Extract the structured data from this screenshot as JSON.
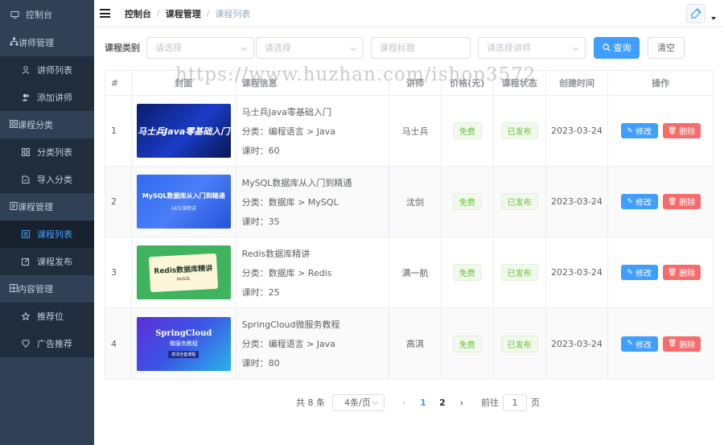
{
  "sidebar": {
    "items": [
      {
        "label": "控制台",
        "icon": "monitor-icon"
      },
      {
        "label": "讲师管理",
        "icon": "org-chart-icon",
        "group": true
      },
      {
        "label": "讲师列表",
        "icon": "user-icon",
        "sub": true
      },
      {
        "label": "添加讲师",
        "icon": "user-add-icon",
        "sub": true
      },
      {
        "label": "课程分类",
        "icon": "grid-icon",
        "group": true
      },
      {
        "label": "分类列表",
        "icon": "grid-icon",
        "sub": true
      },
      {
        "label": "导入分类",
        "icon": "import-icon",
        "sub": true
      },
      {
        "label": "课程管理",
        "icon": "document-icon",
        "group": true
      },
      {
        "label": "课程列表",
        "icon": "list-icon",
        "sub": true,
        "active": true
      },
      {
        "label": "课程发布",
        "icon": "edit-icon",
        "sub": true
      },
      {
        "label": "内容管理",
        "icon": "tile-icon",
        "group": true
      },
      {
        "label": "推荐位",
        "icon": "star-icon",
        "sub": true
      },
      {
        "label": "广告推荐",
        "icon": "diamond-icon",
        "sub": true
      }
    ]
  },
  "header": {
    "breadcrumb": [
      "控制台",
      "课程管理",
      "课程列表"
    ]
  },
  "filter": {
    "label": "课程类别",
    "select1_placeholder": "请选择",
    "select2_placeholder": "请选择",
    "title_placeholder": "课程标题",
    "teacher_placeholder": "请选择讲师",
    "search_label": "查询",
    "clear_label": "清空"
  },
  "table": {
    "headers": [
      "#",
      "封面",
      "课程信息",
      "讲师",
      "价格(元)",
      "课程状态",
      "创建时间",
      "操作"
    ],
    "rows": [
      {
        "no": "1",
        "cover_text": "马士兵Java零基础入门",
        "title": "马士兵Java零基础入门",
        "category": "分类：编程语言 > Java",
        "hours": "课时：60",
        "teacher": "马士兵",
        "price": "免费",
        "status": "已发布",
        "created": "2023-03-24"
      },
      {
        "no": "2",
        "cover_text": "MySQL数据库从入门到精通",
        "cover_sub": "58次课精讲",
        "title": "MySQL数据库从入门到精通",
        "category": "分类：数据库 > MySQL",
        "hours": "课时：35",
        "teacher": "沈剑",
        "price": "免费",
        "status": "已发布",
        "created": "2023-03-24"
      },
      {
        "no": "3",
        "cover_text": "Redis数据库精讲",
        "cover_sub": "NoSQL",
        "title": "Redis数据库精讲",
        "category": "分类：数据库 > Redis",
        "hours": "课时：25",
        "teacher": "满一航",
        "price": "免费",
        "status": "已发布",
        "created": "2023-03-24"
      },
      {
        "no": "4",
        "cover_text": "SpringCloud",
        "cover_sub": "微服务教程",
        "cover_sub2": "高清全套课程",
        "title": "SpringCloud微服务教程",
        "category": "分类：编程语言 > Java",
        "hours": "课时：80",
        "teacher": "高淇",
        "price": "免费",
        "status": "已发布",
        "created": "2023-03-24"
      }
    ],
    "edit_label": "修改",
    "delete_label": "删除"
  },
  "pagination": {
    "total": "共 8 条",
    "page_size": "4条/页",
    "pages": [
      "1",
      "2"
    ],
    "current": "1",
    "goto_prefix": "前往",
    "goto_value": "1",
    "goto_suffix": "页"
  },
  "watermark": "https://www.huzhan.com/ishop3572",
  "colors": {
    "sidebar_bg": "#304156",
    "primary": "#409eff",
    "danger": "#f56c6c",
    "success": "#67c23a"
  }
}
